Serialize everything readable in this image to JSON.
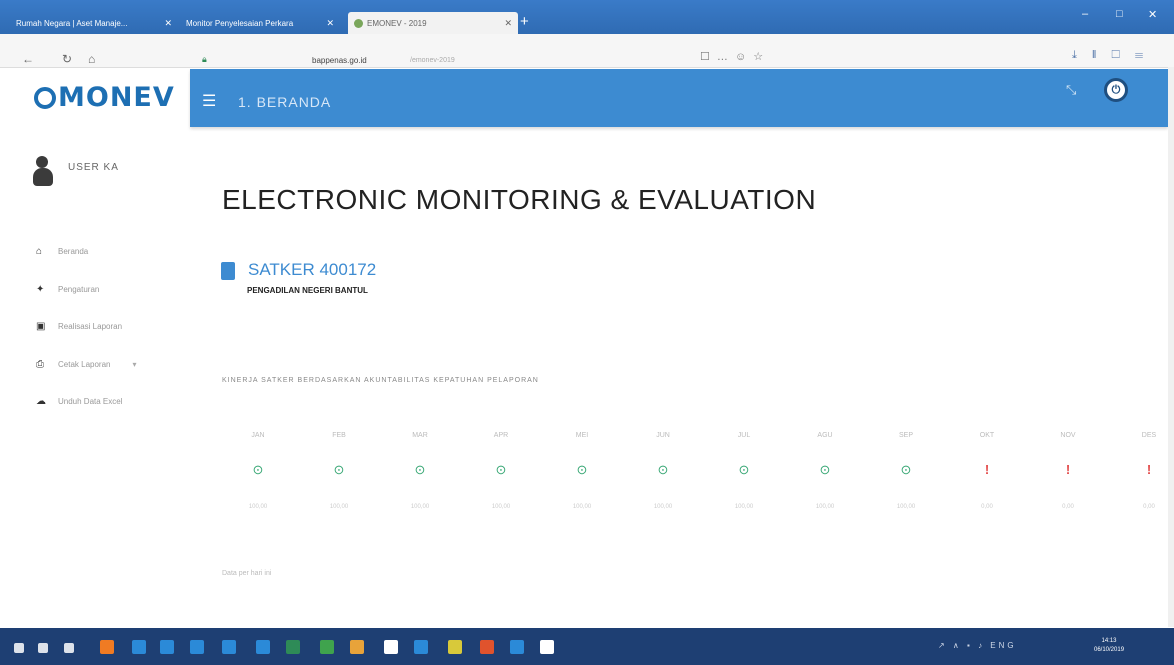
{
  "browser": {
    "tabs": [
      {
        "label": "Rumah Negara | Aset Manaje..."
      },
      {
        "label": "Monitor Penyelesaian Perkara"
      },
      {
        "label": "EMONEV - 2019"
      }
    ],
    "new_tab": "+",
    "url": "bappenas.go.id",
    "url_extra": "/emonev-2019",
    "page_actions": "☐ … ☺ ☆",
    "toolbar_icons": "⤓ ‖ ☐ ☰",
    "window_controls": [
      "–",
      "□",
      "✕"
    ]
  },
  "app": {
    "logo": "MONEV",
    "page_title": "1. BERANDA",
    "user_button": "⏻",
    "fullscreen_icon": "⤡"
  },
  "sidebar": {
    "user": "USER KA",
    "items": [
      {
        "icon": "home-icon",
        "glyph": "⌂",
        "label": "Beranda"
      },
      {
        "icon": "settings-icon",
        "glyph": "✦",
        "label": "Pengaturan"
      },
      {
        "icon": "report-icon",
        "glyph": "▣",
        "label": "Realisasi Laporan"
      },
      {
        "icon": "print-icon",
        "glyph": "⎙",
        "label": "Cetak Laporan",
        "has_dropdown": true
      },
      {
        "icon": "upload-icon",
        "glyph": "☁",
        "label": "Unduh Data Excel"
      }
    ]
  },
  "main": {
    "headline": "ELECTRONIC MONITORING & EVALUATION",
    "satker_code": "SATKER 400172",
    "satker_name": "PENGADILAN NEGERI BANTUL",
    "performance_label": "KINERJA SATKER BERDASARKAN AKUNTABILITAS KEPATUHAN PELAPORAN",
    "months": [
      {
        "name": "JAN",
        "status": "ok",
        "value": "100,00"
      },
      {
        "name": "FEB",
        "status": "ok",
        "value": "100,00"
      },
      {
        "name": "MAR",
        "status": "ok",
        "value": "100,00"
      },
      {
        "name": "APR",
        "status": "ok",
        "value": "100,00"
      },
      {
        "name": "MEI",
        "status": "ok",
        "value": "100,00"
      },
      {
        "name": "JUN",
        "status": "ok",
        "value": "100,00"
      },
      {
        "name": "JUL",
        "status": "ok",
        "value": "100,00"
      },
      {
        "name": "AGU",
        "status": "ok",
        "value": "100,00"
      },
      {
        "name": "SEP",
        "status": "ok",
        "value": "100,00"
      },
      {
        "name": "OKT",
        "status": "warn",
        "value": "0,00"
      },
      {
        "name": "NOV",
        "status": "warn",
        "value": "0,00"
      },
      {
        "name": "DES",
        "status": "warn",
        "value": "0,00"
      }
    ],
    "status_glyphs": {
      "ok": "⊙",
      "warn": "!"
    },
    "footnote": "Data per hari ini"
  },
  "taskbar": {
    "system_tray": "↗ ∧ ▪ ♪ ENG",
    "time": "14:13",
    "date": "06/10/2019"
  },
  "colors": {
    "accent": "#3d8bd1",
    "ok": "#3aa876",
    "warn": "#e34b4b"
  }
}
